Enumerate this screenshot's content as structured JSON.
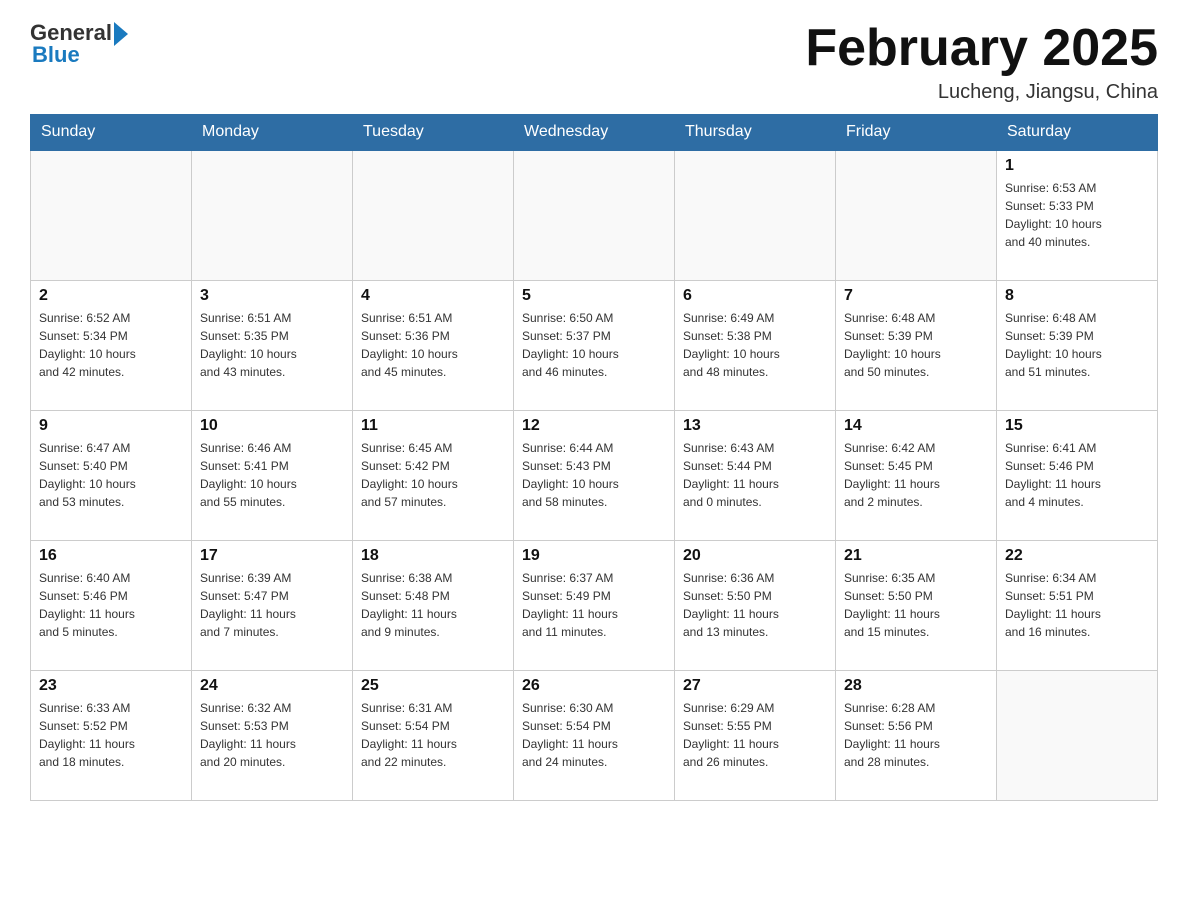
{
  "header": {
    "logo_general": "General",
    "logo_blue": "Blue",
    "month_title": "February 2025",
    "location": "Lucheng, Jiangsu, China"
  },
  "weekdays": [
    "Sunday",
    "Monday",
    "Tuesday",
    "Wednesday",
    "Thursday",
    "Friday",
    "Saturday"
  ],
  "weeks": [
    [
      {
        "day": "",
        "info": ""
      },
      {
        "day": "",
        "info": ""
      },
      {
        "day": "",
        "info": ""
      },
      {
        "day": "",
        "info": ""
      },
      {
        "day": "",
        "info": ""
      },
      {
        "day": "",
        "info": ""
      },
      {
        "day": "1",
        "info": "Sunrise: 6:53 AM\nSunset: 5:33 PM\nDaylight: 10 hours\nand 40 minutes."
      }
    ],
    [
      {
        "day": "2",
        "info": "Sunrise: 6:52 AM\nSunset: 5:34 PM\nDaylight: 10 hours\nand 42 minutes."
      },
      {
        "day": "3",
        "info": "Sunrise: 6:51 AM\nSunset: 5:35 PM\nDaylight: 10 hours\nand 43 minutes."
      },
      {
        "day": "4",
        "info": "Sunrise: 6:51 AM\nSunset: 5:36 PM\nDaylight: 10 hours\nand 45 minutes."
      },
      {
        "day": "5",
        "info": "Sunrise: 6:50 AM\nSunset: 5:37 PM\nDaylight: 10 hours\nand 46 minutes."
      },
      {
        "day": "6",
        "info": "Sunrise: 6:49 AM\nSunset: 5:38 PM\nDaylight: 10 hours\nand 48 minutes."
      },
      {
        "day": "7",
        "info": "Sunrise: 6:48 AM\nSunset: 5:39 PM\nDaylight: 10 hours\nand 50 minutes."
      },
      {
        "day": "8",
        "info": "Sunrise: 6:48 AM\nSunset: 5:39 PM\nDaylight: 10 hours\nand 51 minutes."
      }
    ],
    [
      {
        "day": "9",
        "info": "Sunrise: 6:47 AM\nSunset: 5:40 PM\nDaylight: 10 hours\nand 53 minutes."
      },
      {
        "day": "10",
        "info": "Sunrise: 6:46 AM\nSunset: 5:41 PM\nDaylight: 10 hours\nand 55 minutes."
      },
      {
        "day": "11",
        "info": "Sunrise: 6:45 AM\nSunset: 5:42 PM\nDaylight: 10 hours\nand 57 minutes."
      },
      {
        "day": "12",
        "info": "Sunrise: 6:44 AM\nSunset: 5:43 PM\nDaylight: 10 hours\nand 58 minutes."
      },
      {
        "day": "13",
        "info": "Sunrise: 6:43 AM\nSunset: 5:44 PM\nDaylight: 11 hours\nand 0 minutes."
      },
      {
        "day": "14",
        "info": "Sunrise: 6:42 AM\nSunset: 5:45 PM\nDaylight: 11 hours\nand 2 minutes."
      },
      {
        "day": "15",
        "info": "Sunrise: 6:41 AM\nSunset: 5:46 PM\nDaylight: 11 hours\nand 4 minutes."
      }
    ],
    [
      {
        "day": "16",
        "info": "Sunrise: 6:40 AM\nSunset: 5:46 PM\nDaylight: 11 hours\nand 5 minutes."
      },
      {
        "day": "17",
        "info": "Sunrise: 6:39 AM\nSunset: 5:47 PM\nDaylight: 11 hours\nand 7 minutes."
      },
      {
        "day": "18",
        "info": "Sunrise: 6:38 AM\nSunset: 5:48 PM\nDaylight: 11 hours\nand 9 minutes."
      },
      {
        "day": "19",
        "info": "Sunrise: 6:37 AM\nSunset: 5:49 PM\nDaylight: 11 hours\nand 11 minutes."
      },
      {
        "day": "20",
        "info": "Sunrise: 6:36 AM\nSunset: 5:50 PM\nDaylight: 11 hours\nand 13 minutes."
      },
      {
        "day": "21",
        "info": "Sunrise: 6:35 AM\nSunset: 5:50 PM\nDaylight: 11 hours\nand 15 minutes."
      },
      {
        "day": "22",
        "info": "Sunrise: 6:34 AM\nSunset: 5:51 PM\nDaylight: 11 hours\nand 16 minutes."
      }
    ],
    [
      {
        "day": "23",
        "info": "Sunrise: 6:33 AM\nSunset: 5:52 PM\nDaylight: 11 hours\nand 18 minutes."
      },
      {
        "day": "24",
        "info": "Sunrise: 6:32 AM\nSunset: 5:53 PM\nDaylight: 11 hours\nand 20 minutes."
      },
      {
        "day": "25",
        "info": "Sunrise: 6:31 AM\nSunset: 5:54 PM\nDaylight: 11 hours\nand 22 minutes."
      },
      {
        "day": "26",
        "info": "Sunrise: 6:30 AM\nSunset: 5:54 PM\nDaylight: 11 hours\nand 24 minutes."
      },
      {
        "day": "27",
        "info": "Sunrise: 6:29 AM\nSunset: 5:55 PM\nDaylight: 11 hours\nand 26 minutes."
      },
      {
        "day": "28",
        "info": "Sunrise: 6:28 AM\nSunset: 5:56 PM\nDaylight: 11 hours\nand 28 minutes."
      },
      {
        "day": "",
        "info": ""
      }
    ]
  ]
}
